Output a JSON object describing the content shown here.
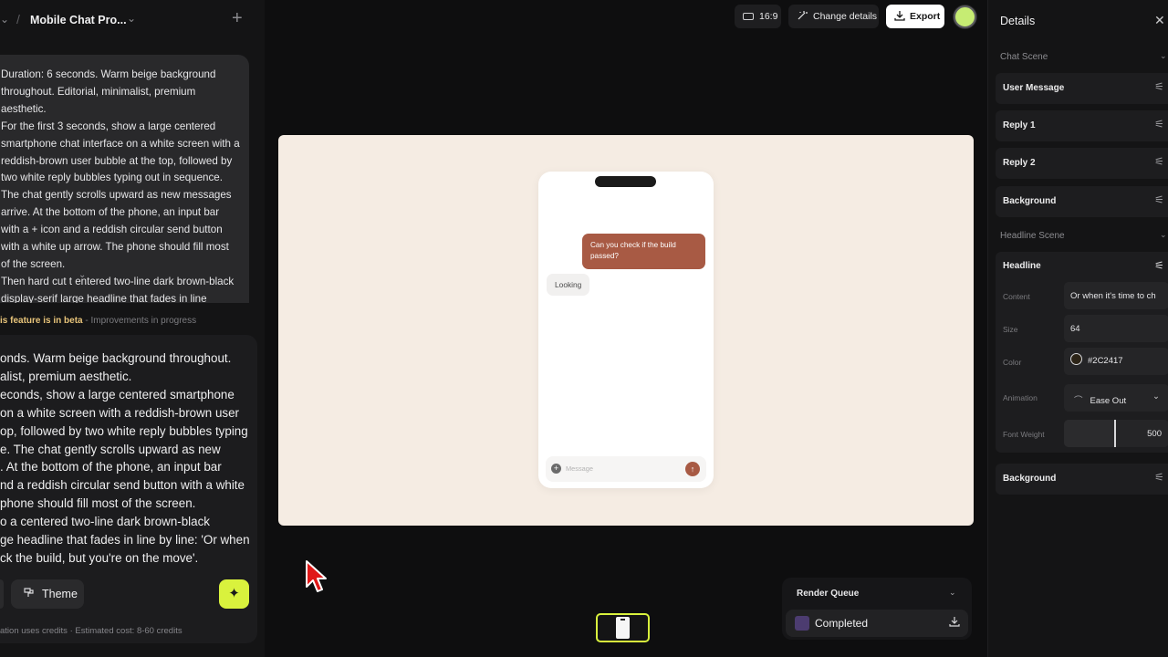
{
  "left_panel": {
    "project_name": "Mobile Chat Pro...",
    "prompt_text": "Duration: 6 seconds. Warm beige background throughout. Editorial, minimalist, premium aesthetic.\nFor the first 3 seconds, show a large centered smartphone chat interface on a white screen with a reddish-brown user bubble at the top, followed by two white reply bubbles typing out in sequence. The chat gently scrolls upward as new messages arrive. At the bottom of the phone, an input bar with a + icon and a reddish circular send button with a white up arrow. The phone should fill most of the screen.\nThen hard cut t  entered two-line dark brown-black display-serif large headline that fades in line",
    "beta_label": "is feature is in beta",
    "beta_note": " - Improvements in progress",
    "input_text": "onds. Warm beige background throughout.\nalist, premium aesthetic.\neconds, show a large centered smartphone\non a white screen with a reddish-brown user\nop, followed by two white reply bubbles typing\ne. The chat gently scrolls upward as new\n. At the bottom of the phone, an input bar\nnd a reddish circular send button with a white\nphone should fill most of the screen.\no a centered two-line dark brown-black\nge headline that fades in line by line: 'Or when\nck the build, but you're on the move'.",
    "theme_label": "Theme",
    "credits_text": "ation uses credits · Estimated cost: 8-60 credits"
  },
  "toolbar": {
    "aspect_label": "16:9",
    "change_label": "Change details",
    "export_label": "Export"
  },
  "preview": {
    "user_message": "Can you check if the build passed?",
    "reply_text": "Looking",
    "input_placeholder": "Message"
  },
  "render_queue": {
    "title": "Render Queue",
    "status": "Completed"
  },
  "details": {
    "title": "Details",
    "section_chat": "Chat Scene",
    "chat_items": [
      "User Message",
      "Reply 1",
      "Reply 2",
      "Background"
    ],
    "section_headline": "Headline Scene",
    "headline_label": "Headline",
    "props": {
      "content_label": "Content",
      "content_value": "Or when it's time to ch",
      "size_label": "Size",
      "size_value": "64",
      "color_label": "Color",
      "color_value": "#2C2417",
      "animation_label": "Animation",
      "animation_value": "Ease Out",
      "weight_label": "Font Weight",
      "weight_value": "500"
    },
    "background_label": "Background"
  },
  "colors": {
    "accent": "#d9f23d",
    "canvas_bg": "#f5ece3",
    "user_bubble": "#a85a44",
    "headline_color": "#2C2417"
  },
  "icons": [
    "chevron-left-icon",
    "plus-icon",
    "aspect-icon",
    "wand-icon",
    "download-icon",
    "sparkle-icon",
    "theme-icon",
    "close-icon",
    "sliders-icon",
    "chevron-down-icon",
    "send-icon"
  ]
}
